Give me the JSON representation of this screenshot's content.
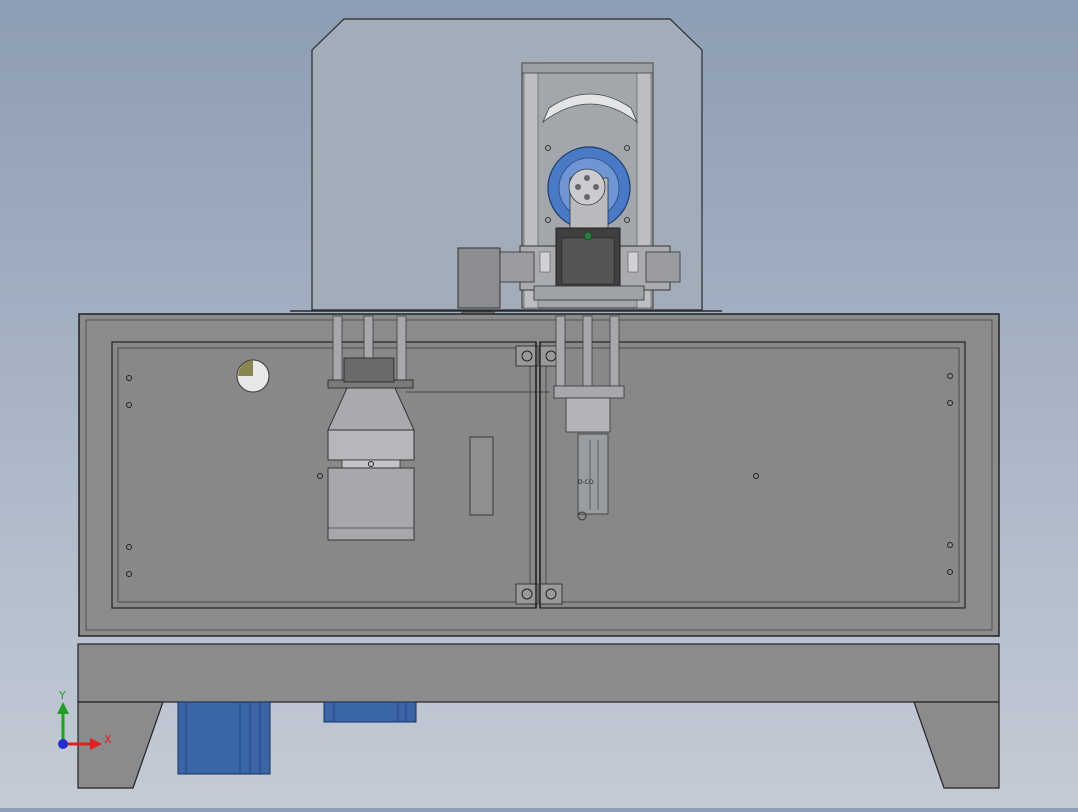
{
  "viewport": {
    "background_top": "#8d9db3",
    "background_bottom": "#c4cbd6",
    "body_color": "#8c8c8c",
    "panel_color": "#8a8a8a",
    "guard_color": "#a4adb9",
    "motor_color": "#3a66a8",
    "disc_color": "#4a7ac6"
  },
  "parts": {
    "nameplate_text": "D-CO"
  },
  "triad": {
    "x_label": "X",
    "y_label": "Y",
    "x_color": "#e02020",
    "y_color": "#20a020",
    "z_color": "#2030d0"
  }
}
